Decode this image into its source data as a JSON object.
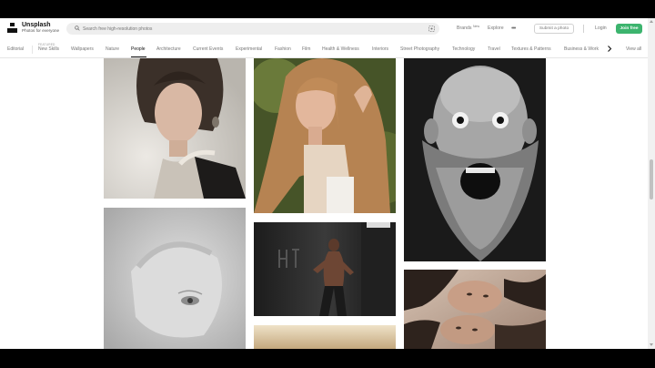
{
  "header": {
    "brand_name": "Unsplash",
    "brand_tagline": "Photos for everyone",
    "search_placeholder": "Search free high-resolution photos",
    "nav": {
      "brands": "Brands",
      "new_badge": "New",
      "explore": "Explore",
      "submit": "Submit a photo",
      "login": "Login",
      "join": "Join free"
    }
  },
  "topics": {
    "editorial": "Editorial",
    "featured_label": "FEATURED",
    "items": [
      "New Skills",
      "Wallpapers",
      "Nature",
      "People",
      "Architecture",
      "Current Events",
      "Experimental",
      "Fashion",
      "Film",
      "Health & Wellness",
      "Interiors",
      "Street Photography",
      "Technology",
      "Travel",
      "Textures & Patterns",
      "Business & Work"
    ],
    "active": "People",
    "view_all": "View all"
  },
  "photos": [
    {
      "subject": "woman with choker necklace"
    },
    {
      "subject": "close-up face in soft grey light"
    },
    {
      "subject": "woman with long blonde hair"
    },
    {
      "subject": "man posing in dark tunnel"
    },
    {
      "subject": "partial warm photo"
    },
    {
      "subject": "bald bearded man shouting"
    },
    {
      "subject": "two women lying on floor"
    }
  ],
  "colors": {
    "accent": "#3cb46e",
    "text": "#111111",
    "muted": "#767676"
  }
}
